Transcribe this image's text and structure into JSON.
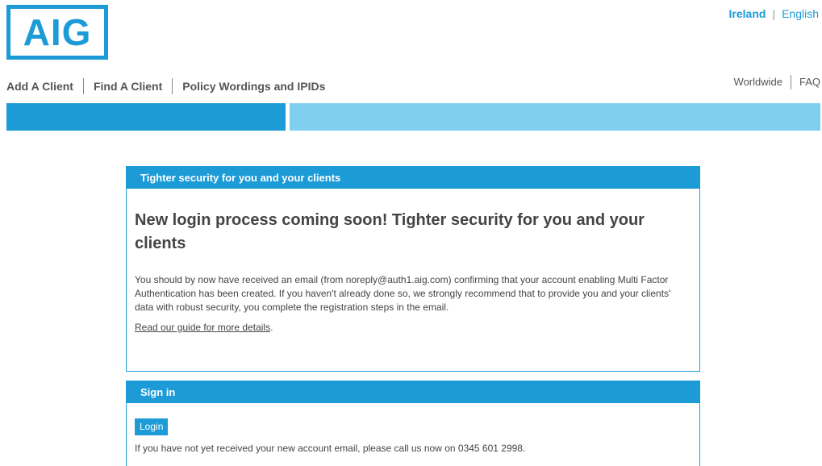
{
  "brand": {
    "logo_text": "AIG",
    "color": "#1c9bd7"
  },
  "locale": {
    "country": "Ireland",
    "separator": "|",
    "language": "English"
  },
  "main_nav": [
    "Add A Client",
    "Find A Client",
    "Policy Wordings and IPIDs"
  ],
  "util_nav": [
    "Worldwide",
    "FAQ"
  ],
  "notice": {
    "header": "Tighter security for you and your clients",
    "heading": "New login process coming soon! Tighter security for you and your clients",
    "body": "You should by now have received an email (from noreply@auth1.aig.com) confirming that your account enabling Multi Factor Authentication has been created. If you haven't already done so, we strongly recommend that to provide you and your clients' data with robust security, you complete the registration steps in the email.",
    "guide_link": "Read our guide for more details",
    "guide_suffix": "."
  },
  "signin": {
    "header": "Sign in",
    "login_label": "Login",
    "help_text": "If you have not yet received your new account email, please call us now on 0345 601 2998."
  }
}
